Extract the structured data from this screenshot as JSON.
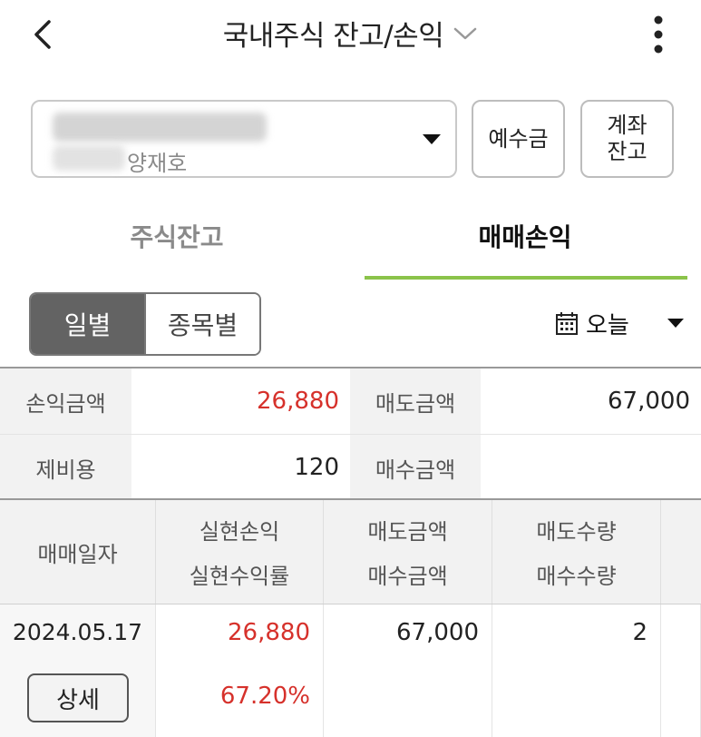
{
  "header": {
    "title": "국내주식 잔고/손익"
  },
  "account": {
    "holder": "양재호"
  },
  "buttons": {
    "deposit": "예수금",
    "balance": "계좌\n잔고"
  },
  "tabs": [
    {
      "label": "주식잔고",
      "active": false
    },
    {
      "label": "매매손익",
      "active": true
    }
  ],
  "segment": [
    {
      "label": "일별",
      "selected": true
    },
    {
      "label": "종목별",
      "selected": false
    }
  ],
  "date_filter": {
    "label": "오늘"
  },
  "summary": {
    "profit_label": "손익금액",
    "profit_value": "26,880",
    "sell_label": "매도금액",
    "sell_value": "67,000",
    "fee_label": "제비용",
    "fee_value": "120",
    "buy_label": "매수금액",
    "buy_value": ""
  },
  "table": {
    "headers": {
      "date": "매매일자",
      "realized_pl": "실현손익",
      "realized_rate": "실현수익률",
      "sell_amount": "매도금액",
      "buy_amount": "매수금액",
      "sell_qty": "매도수량",
      "buy_qty": "매수수량"
    },
    "rows": [
      {
        "date": "2024.05.17",
        "detail_label": "상세",
        "realized_pl": "26,880",
        "realized_rate": "67.20%",
        "sell_amount": "67,000",
        "buy_amount": "",
        "sell_qty": "2",
        "buy_qty": ""
      }
    ]
  },
  "colors": {
    "accent_green": "#8bc34a",
    "profit_red": "#d6312b",
    "segment_active": "#636363"
  }
}
